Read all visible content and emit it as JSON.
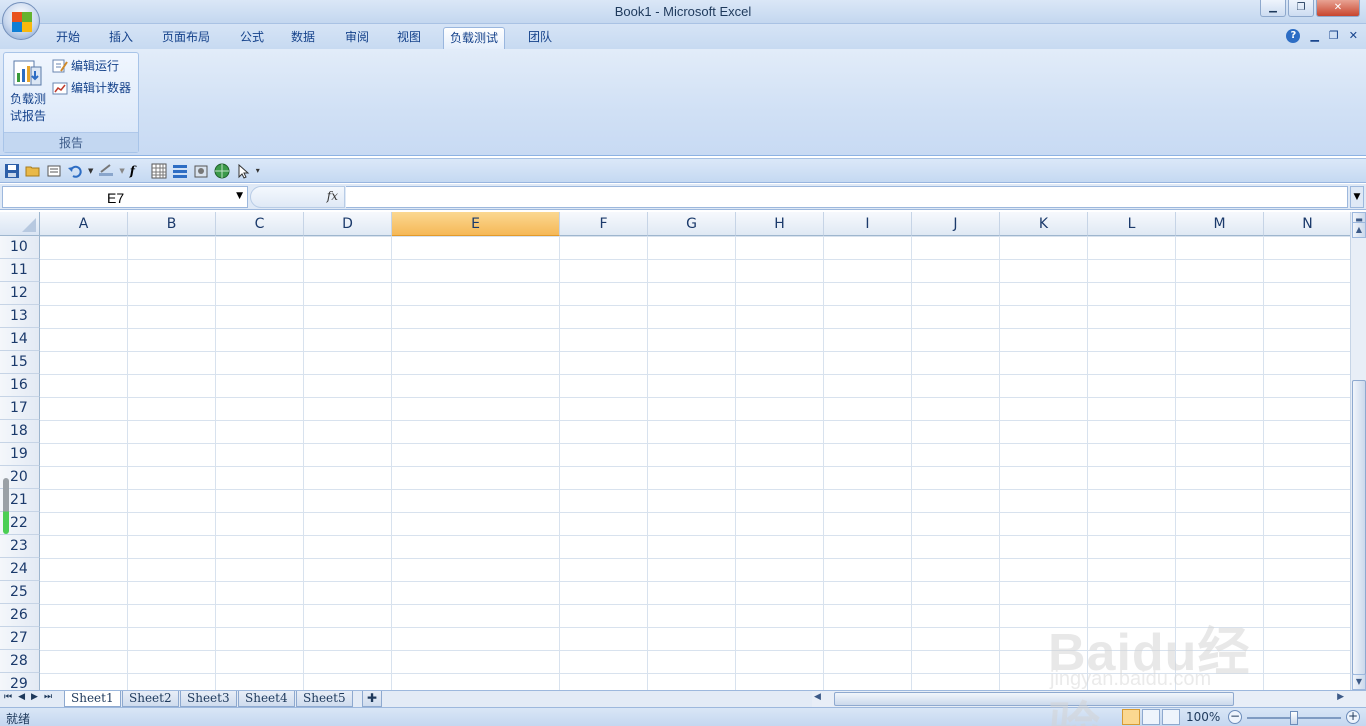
{
  "window": {
    "title": "Book1 - Microsoft Excel"
  },
  "ribbon_tabs": [
    "开始",
    "插入",
    "页面布局",
    "公式",
    "数据",
    "审阅",
    "视图",
    "负载测试",
    "团队"
  ],
  "active_tab": "负载测试",
  "ribbon": {
    "group_label": "报告",
    "big_button": {
      "line1": "负载测",
      "line2": "试报告"
    },
    "small_buttons": [
      "编辑运行",
      "编辑计数器"
    ]
  },
  "formula_bar": {
    "name_box": "E7",
    "fx": "fx",
    "formula": ""
  },
  "columns": [
    "A",
    "B",
    "C",
    "D",
    "E",
    "F",
    "G",
    "H",
    "I",
    "J",
    "K",
    "L",
    "M",
    "N"
  ],
  "active_column": "E",
  "rows": [
    "10",
    "11",
    "12",
    "13",
    "14",
    "15",
    "16",
    "17",
    "18",
    "19",
    "20",
    "21",
    "22",
    "23",
    "24",
    "25",
    "26",
    "27",
    "28",
    "29"
  ],
  "sheets": [
    "Sheet1",
    "Sheet2",
    "Sheet3",
    "Sheet4",
    "Sheet5"
  ],
  "active_sheet": "Sheet1",
  "status": {
    "text": "就绪",
    "zoom": "100%"
  },
  "watermark": {
    "brand": "Baidu经验",
    "url": "jingyan.baidu.com"
  },
  "colors": {
    "accent": "#15428b",
    "active_header": "#f5b857",
    "ribbon": "#d0e0f5"
  }
}
